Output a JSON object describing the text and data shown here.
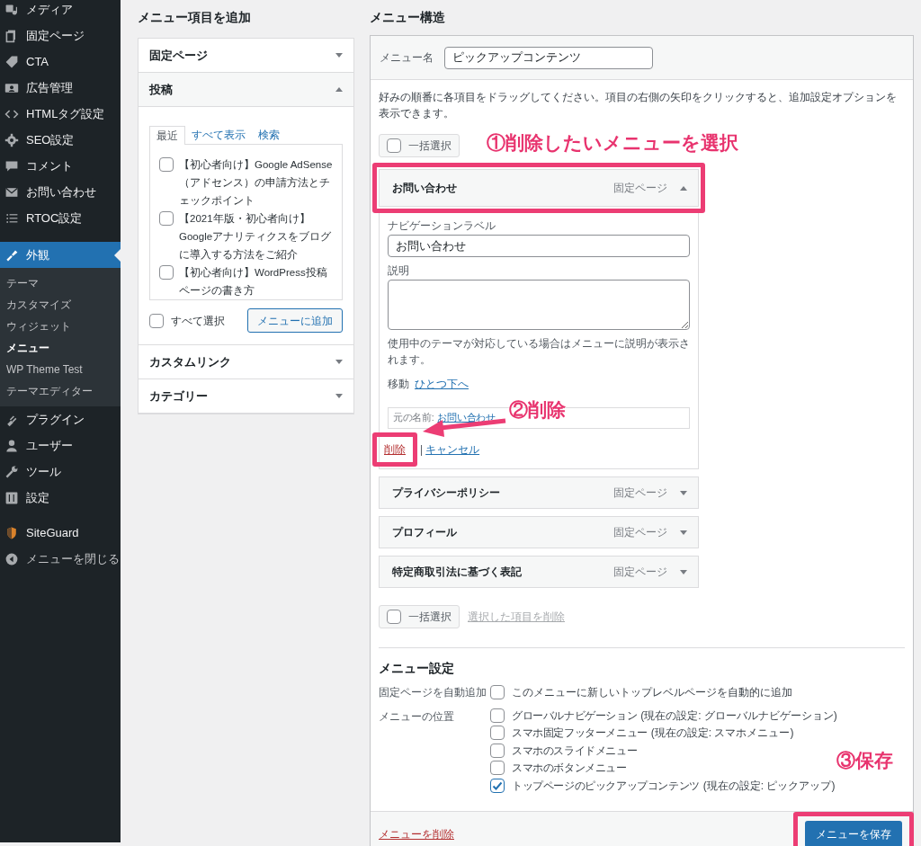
{
  "sidebar": {
    "items": [
      {
        "label": "メディア",
        "selected": false
      },
      {
        "label": "固定ページ",
        "selected": false
      },
      {
        "label": "CTA",
        "selected": false
      },
      {
        "label": "広告管理",
        "selected": false
      },
      {
        "label": "HTMLタグ設定",
        "selected": false
      },
      {
        "label": "SEO設定",
        "selected": false
      },
      {
        "label": "コメント",
        "selected": false
      },
      {
        "label": "お問い合わせ",
        "selected": false
      },
      {
        "label": "RTOC設定",
        "selected": false
      },
      {
        "label": "外観",
        "selected": true,
        "children": [
          {
            "label": "テーマ",
            "selected": false
          },
          {
            "label": "カスタマイズ",
            "selected": false
          },
          {
            "label": "ウィジェット",
            "selected": false
          },
          {
            "label": "メニュー",
            "selected": true
          },
          {
            "label": "WP Theme Test",
            "selected": false
          },
          {
            "label": "テーマエディター",
            "selected": false
          }
        ]
      },
      {
        "label": "プラグイン",
        "selected": false
      },
      {
        "label": "ユーザー",
        "selected": false
      },
      {
        "label": "ツール",
        "selected": false
      },
      {
        "label": "設定",
        "selected": false
      },
      {
        "label": "SiteGuard",
        "selected": false
      },
      {
        "label": "メニューを閉じる",
        "selected": false
      }
    ]
  },
  "add_items": {
    "heading": "メニュー項目を追加",
    "sections": [
      {
        "title": "固定ページ",
        "expanded": false
      },
      {
        "title": "投稿",
        "expanded": true,
        "tabs": [
          {
            "label": "最近",
            "selected": true
          },
          {
            "label": "すべて表示",
            "selected": false
          },
          {
            "label": "検索",
            "selected": false
          }
        ],
        "posts": [
          {
            "label": "【初心者向け】Google AdSense（アドセンス）の申請方法とチェックポイント",
            "checked": false
          },
          {
            "label": "【2021年版・初心者向け】Googleアナリティクスをブログに導入する方法をご紹介",
            "checked": false
          },
          {
            "label": "【初心者向け】WordPress投稿ページの書き方",
            "checked": false
          }
        ],
        "select_all": {
          "label": "すべて選択",
          "checked": false
        },
        "add_button": "メニューに追加"
      },
      {
        "title": "カスタムリンク",
        "expanded": false
      },
      {
        "title": "カテゴリー",
        "expanded": false
      }
    ]
  },
  "structure": {
    "heading": "メニュー構造",
    "name_label": "メニュー名",
    "name_value": "ピックアップコンテンツ",
    "instructions": "好みの順番に各項目をドラッグしてください。項目の右側の矢印をクリックすると、追加設定オプションを表示できます。",
    "bulk_select_top": {
      "label": "一括選択",
      "checked": false
    },
    "items": [
      {
        "title": "お問い合わせ",
        "type": "固定ページ",
        "expanded": true,
        "nav_label_caption": "ナビゲーションラベル",
        "nav_label_value": "お問い合わせ",
        "description_caption": "説明",
        "description_help": "使用中のテーマが対応している場合はメニューに説明が表示されます。",
        "move_caption": "移動",
        "move_link": "ひとつ下へ",
        "original_caption": "元の名前:",
        "original_link": "お問い合わせ",
        "remove_link": "削除",
        "separator": "|",
        "cancel_link": "キャンセル"
      },
      {
        "title": "プライバシーポリシー",
        "type": "固定ページ",
        "expanded": false
      },
      {
        "title": "プロフィール",
        "type": "固定ページ",
        "expanded": false
      },
      {
        "title": "特定商取引法に基づく表記",
        "type": "固定ページ",
        "expanded": false
      }
    ],
    "bulk_select_bottom": {
      "label": "一括選択",
      "checked": false
    },
    "delete_selected": {
      "label": "選択した項目を削除",
      "disabled": true
    },
    "settings": {
      "heading": "メニュー設定",
      "auto_add": {
        "caption": "固定ページを自動追加",
        "label": "このメニューに新しいトップレベルページを自動的に追加",
        "checked": false
      },
      "locations_caption": "メニューの位置",
      "locations": [
        {
          "label": "グローバルナビゲーション",
          "note": "(現在の設定: グローバルナビゲーション)",
          "checked": false
        },
        {
          "label": "スマホ固定フッターメニュー",
          "note": "(現在の設定: スマホメニュー)",
          "checked": false
        },
        {
          "label": "スマホのスライドメニュー",
          "checked": false
        },
        {
          "label": "スマホのボタンメニュー",
          "checked": false
        },
        {
          "label": "トップページのピックアップコンテンツ",
          "note": "(現在の設定: ピックアップ)",
          "checked": true
        }
      ]
    },
    "delete_menu_link": "メニューを削除",
    "save_button": "メニューを保存"
  },
  "annotations": [
    {
      "text": "①削除したいメニューを選択"
    },
    {
      "text": "②削除"
    },
    {
      "text": "③保存"
    }
  ]
}
